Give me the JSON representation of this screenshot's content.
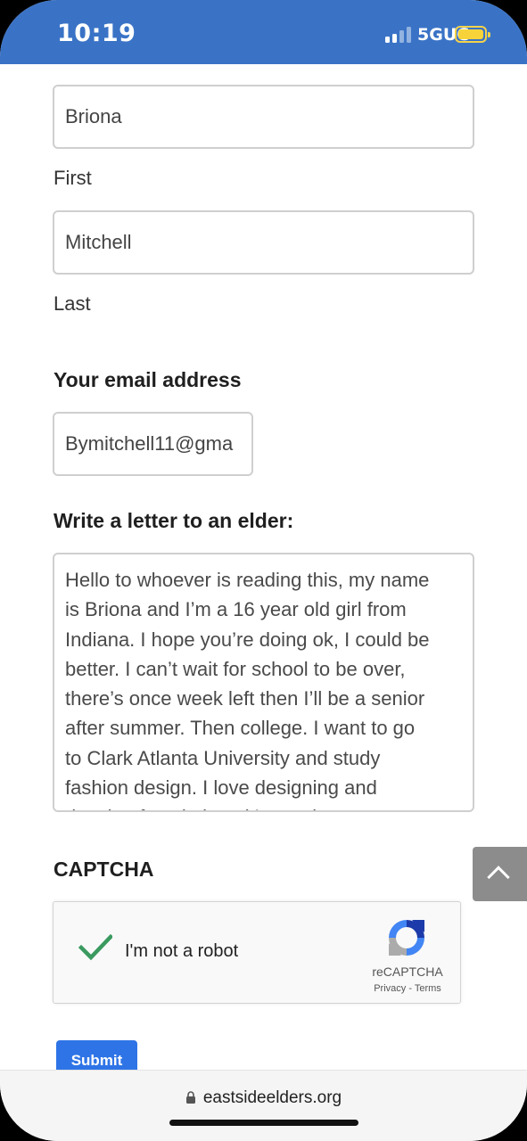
{
  "status_bar": {
    "time": "10:19",
    "network": "5GUC",
    "battery_level": 1.0
  },
  "form": {
    "first_name_value": "Briona",
    "first_label": "First",
    "last_name_value": "Mitchell",
    "last_label": "Last",
    "email_label": "Your email address",
    "email_value": "Bymitchell11@gma",
    "letter_label": "Write a letter to an elder:",
    "letter_lines": [
      "Hello to whoever is reading this, my name",
      "is Briona and I’m a 16 year old girl from",
      "Indiana. I hope you’re doing ok, I could be",
      "better. I can’t wait for school to be over,",
      "there’s once week left then I’ll be a senior",
      "after summer. Then college. I want to go",
      "to Clark Atlanta University and study",
      "fashion design. I love designing and",
      "drawing fun clothes, it’s my dream to"
    ],
    "captcha_label": "CAPTCHA",
    "submit_label": "Submit"
  },
  "recaptcha": {
    "checkbox_label": "I'm not a robot",
    "brand": "reCAPTCHA",
    "privacy": "Privacy",
    "separator": "-",
    "terms": "Terms",
    "checked": true
  },
  "browser": {
    "url": "eastsideelders.org"
  },
  "colors": {
    "status_bar": "#3a73c6",
    "submit": "#2e74e6",
    "check": "#3a9a5f"
  }
}
